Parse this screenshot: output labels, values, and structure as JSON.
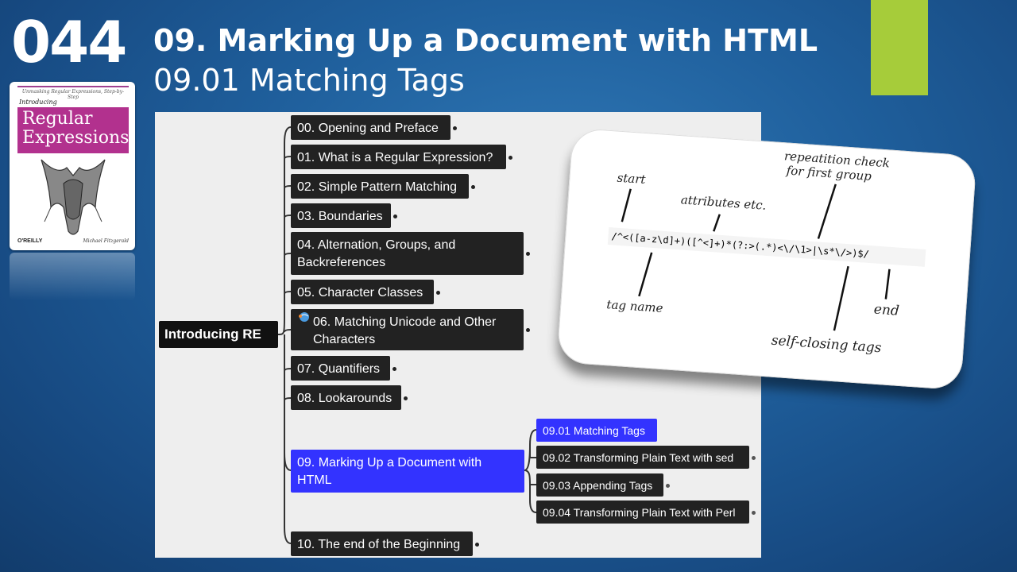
{
  "slide_number": "044",
  "title": "09. Marking Up a Document with HTML",
  "subtitle": "09.01 Matching Tags",
  "colors": {
    "accent": "#a6cc3a",
    "selected": "#3333ff",
    "node": "#222222",
    "panel": "#eeeeee"
  },
  "book": {
    "tagline": "Unmasking Regular Expressions, Step-by-Step",
    "intro": "Introducing",
    "title_line1": "Regular",
    "title_line2": "Expressions",
    "publisher": "O'REILLY",
    "author": "Michael Fitzgerald"
  },
  "mindmap": {
    "root": "Introducing RE",
    "chapters": [
      "00. Opening and Preface",
      "01. What is a Regular Expression?",
      "02. Simple Pattern Matching",
      "03. Boundaries",
      "04. Alternation, Groups, and Backreferences",
      "05. Character Classes",
      "06. Matching Unicode and Other Characters",
      "07. Quantifiers",
      "08. Lookarounds",
      "09. Marking Up a Document with HTML",
      "10. The end of the Beginning"
    ],
    "sections": [
      "09.01 Matching Tags",
      "09.02 Transforming Plain Text with sed",
      "09.03 Appending Tags",
      "09.04 Transforming Plain Text with Perl"
    ]
  },
  "callout": {
    "regex": "/^<([a-z\\d]+)([^<]+)*(?:>(.*)<\\/\\1>|\\s*\\/>)$/",
    "labels": {
      "start": "start",
      "attributes": "attributes etc.",
      "repetition": "repeatition check",
      "repetition2": "for first group",
      "tag_name": "tag name",
      "end": "end",
      "self_closing": "self-closing tags"
    }
  }
}
